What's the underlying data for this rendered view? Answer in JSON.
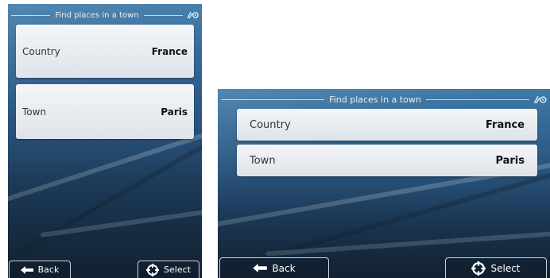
{
  "screens": {
    "portrait": {
      "title": "Find places in a town",
      "rows": [
        {
          "label": "Country",
          "value": "France"
        },
        {
          "label": "Town",
          "value": "Paris"
        }
      ],
      "back_label": "Back",
      "select_label": "Select"
    },
    "landscape": {
      "title": "Find places in a town",
      "rows": [
        {
          "label": "Country",
          "value": "France"
        },
        {
          "label": "Town",
          "value": "Paris"
        }
      ],
      "back_label": "Back",
      "select_label": "Select"
    }
  },
  "icons": {
    "status": "gps-satellite-icon",
    "back": "arrow-left-icon",
    "select": "crosshair-icon"
  },
  "colors": {
    "row_bg": "#e8ecf0",
    "screen_bg": "#2c5b86",
    "text_light": "#ffffff"
  }
}
